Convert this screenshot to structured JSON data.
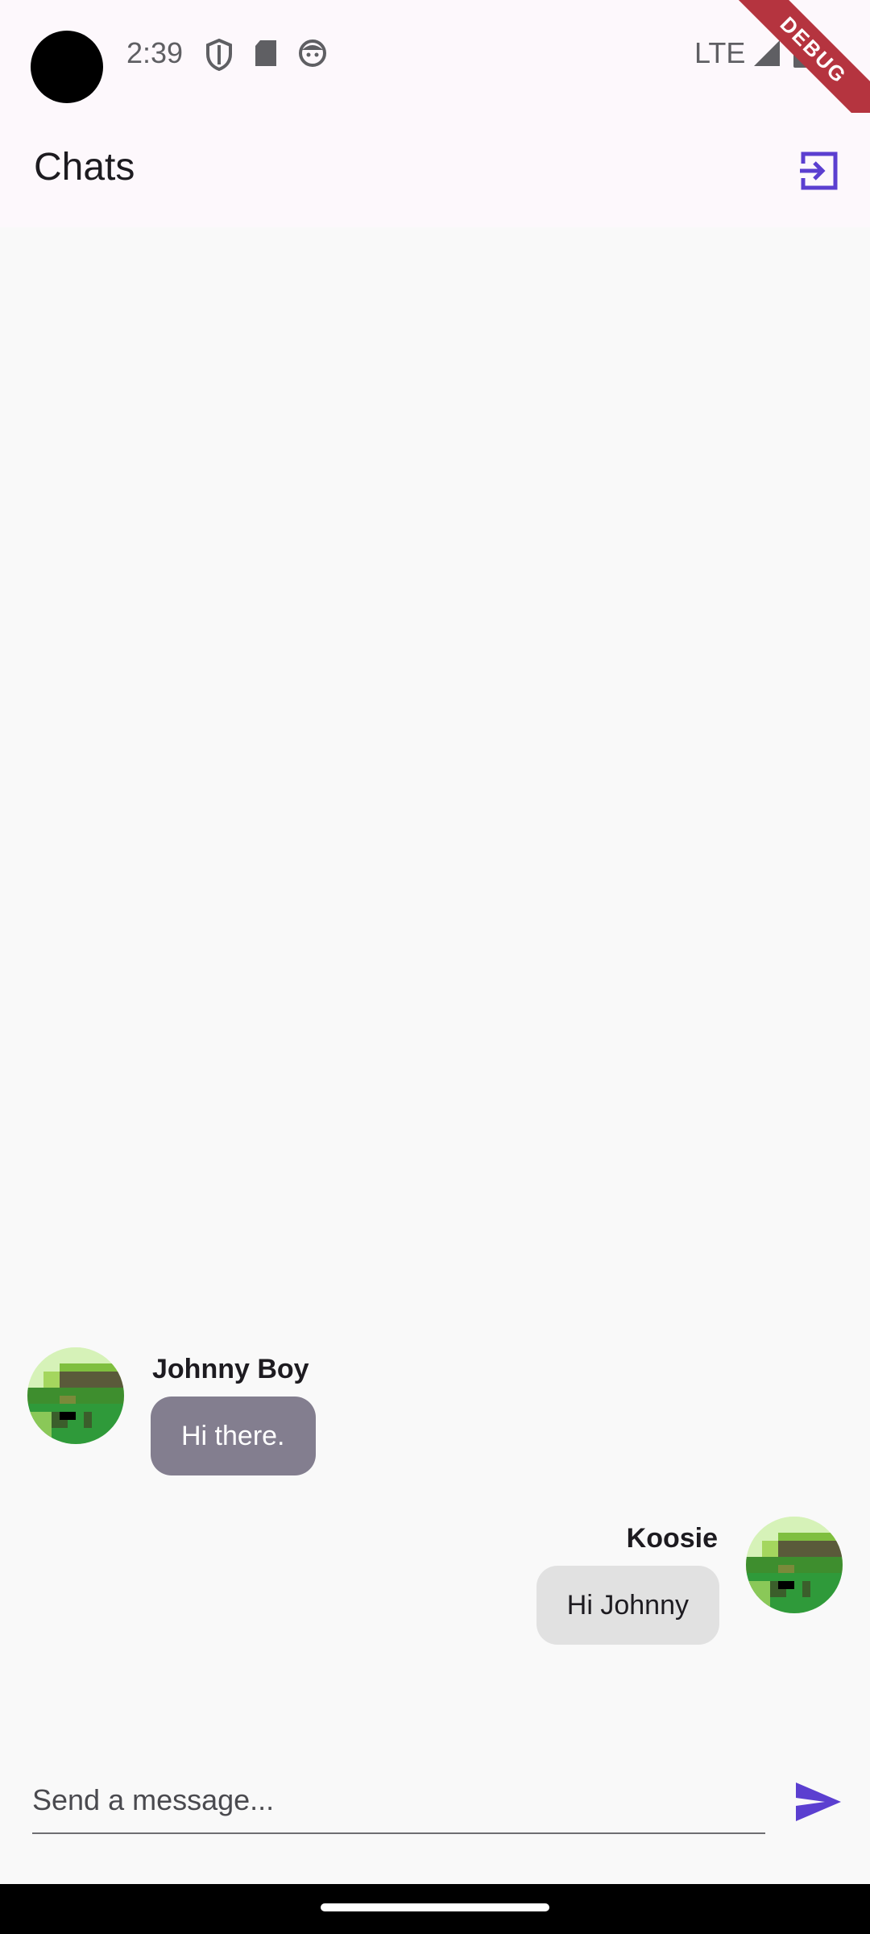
{
  "status_bar": {
    "time": "2:39",
    "network": "LTE",
    "icons": [
      "shield-icon",
      "sd-card-icon",
      "face-icon",
      "signal-icon",
      "battery-icon"
    ]
  },
  "debug_banner": "DEBUG",
  "app_bar": {
    "title": "Chats",
    "action_icon": "logout-icon"
  },
  "messages": [
    {
      "sender": "Johnny Boy",
      "text": "Hi there.",
      "side": "left"
    },
    {
      "sender": "Koosie",
      "text": "Hi Johnny",
      "side": "right"
    }
  ],
  "composer": {
    "placeholder": "Send a message...",
    "value": "",
    "send_icon": "send-icon"
  },
  "colors": {
    "accent": "#5b3fd0",
    "bubble_other": "#837e8f",
    "bubble_self": "#e1e1e1"
  }
}
